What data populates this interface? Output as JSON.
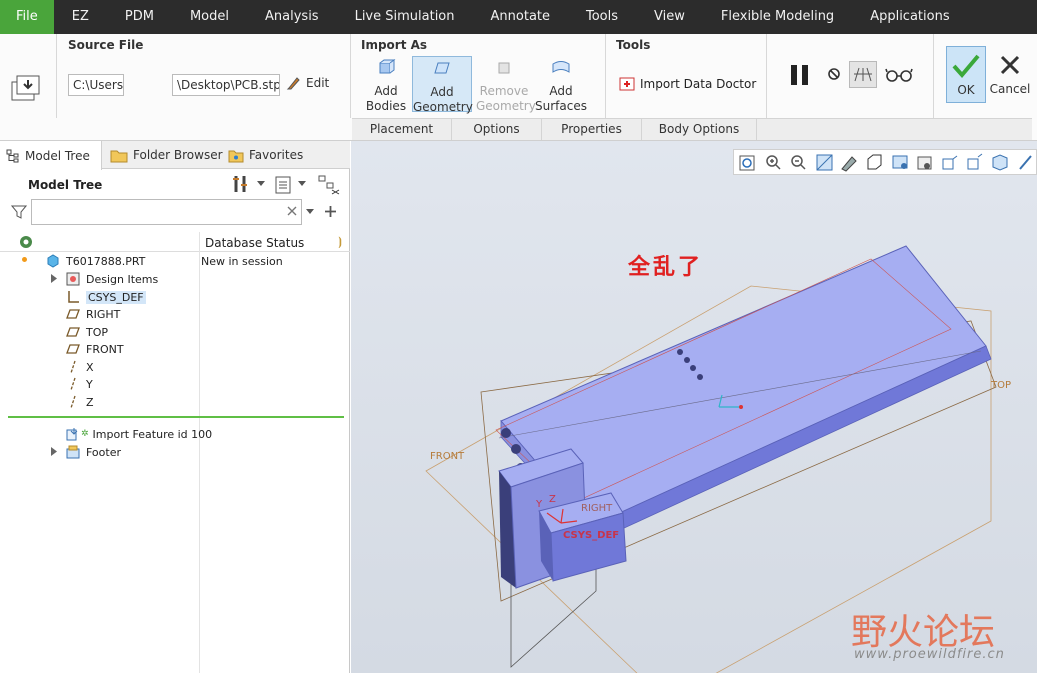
{
  "menu": {
    "items": [
      "File",
      "EZ",
      "PDM",
      "Model",
      "Analysis",
      "Live Simulation",
      "Annotate",
      "Tools",
      "View",
      "Flexible Modeling",
      "Applications"
    ]
  },
  "ribbon": {
    "source_file": {
      "title": "Source File",
      "path_part1": "C:\\Users\\l",
      "path_part2": "\\Desktop\\PCB.stp",
      "edit_label": "Edit"
    },
    "import_as": {
      "title": "Import As",
      "buttons": [
        {
          "line1": "Add",
          "line2": "Bodies"
        },
        {
          "line1": "Add",
          "line2": "Geometry"
        },
        {
          "line1": "Remove",
          "line2": "Geometry"
        },
        {
          "line1": "Add",
          "line2": "Surfaces"
        }
      ]
    },
    "tools": {
      "title": "Tools",
      "import_doctor": "Import Data Doctor"
    },
    "ok_label": "OK",
    "cancel_label": "Cancel",
    "sub_tabs": [
      "Placement",
      "Options",
      "Properties",
      "Body Options"
    ]
  },
  "left_panel": {
    "tabs": [
      "Model Tree",
      "Folder Browser",
      "Favorites"
    ],
    "title": "Model Tree",
    "column_header": "Database Status",
    "tree": [
      {
        "label": "T6017888.PRT",
        "status": "New in session"
      },
      {
        "label": "Design Items"
      },
      {
        "label": "CSYS_DEF"
      },
      {
        "label": "RIGHT"
      },
      {
        "label": "TOP"
      },
      {
        "label": "FRONT"
      },
      {
        "label": "X"
      },
      {
        "label": "Y"
      },
      {
        "label": "Z"
      },
      {
        "label": "Import Feature id 100"
      },
      {
        "label": "Footer"
      }
    ]
  },
  "viewport": {
    "annotation": "全乱了",
    "labels": {
      "front": "FRONT",
      "top": "TOP",
      "right": "RIGHT",
      "csys": "CSYS_DEF",
      "y": "Y",
      "z": "Z"
    },
    "watermark": "野火论坛",
    "watermark_url": "www.proewildfire.cn"
  },
  "colors": {
    "menu_bg": "#2c2c2c",
    "file_tab": "#4aa53b",
    "model_face": "#9fa6f0",
    "selection": "#d6e8f7",
    "annotation": "#e02020"
  }
}
